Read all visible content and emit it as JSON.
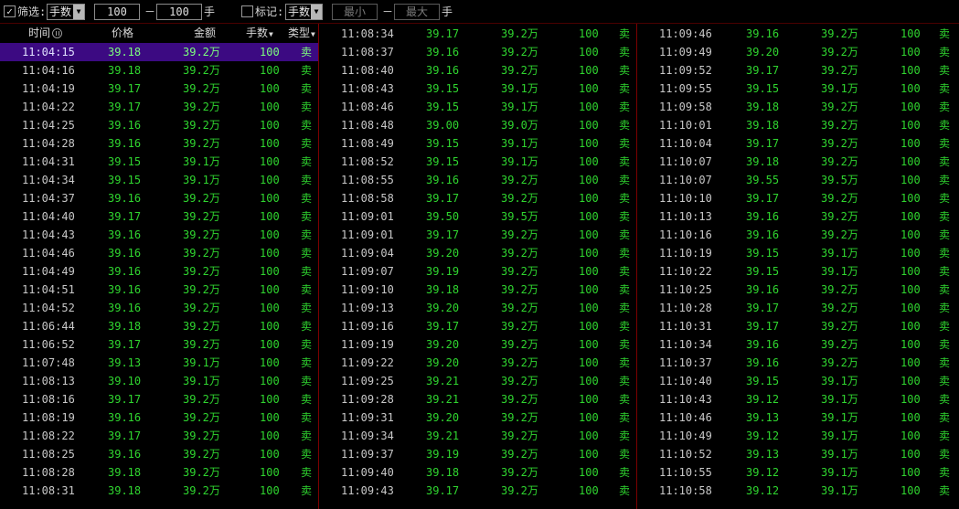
{
  "toolbar": {
    "filter_checked": true,
    "filter_label": "筛选:",
    "filter_field": "手数",
    "min_value": "100",
    "range_dash": "－",
    "max_value": "100",
    "unit": "手",
    "mark_checked": false,
    "mark_label": "标记:",
    "mark_field": "手数",
    "mark_min_placeholder": "最小",
    "mark_dash": "－",
    "mark_max_placeholder": "最大",
    "mark_unit": "手"
  },
  "headers": {
    "time": "时间",
    "price": "价格",
    "amount": "金额",
    "volume": "手数",
    "type": "类型"
  },
  "columns": [
    [
      [
        "11:04:15",
        "39.18",
        "39.2万",
        "100",
        "卖"
      ],
      [
        "11:04:16",
        "39.18",
        "39.2万",
        "100",
        "卖"
      ],
      [
        "11:04:19",
        "39.17",
        "39.2万",
        "100",
        "卖"
      ],
      [
        "11:04:22",
        "39.17",
        "39.2万",
        "100",
        "卖"
      ],
      [
        "11:04:25",
        "39.16",
        "39.2万",
        "100",
        "卖"
      ],
      [
        "11:04:28",
        "39.16",
        "39.2万",
        "100",
        "卖"
      ],
      [
        "11:04:31",
        "39.15",
        "39.1万",
        "100",
        "卖"
      ],
      [
        "11:04:34",
        "39.15",
        "39.1万",
        "100",
        "卖"
      ],
      [
        "11:04:37",
        "39.16",
        "39.2万",
        "100",
        "卖"
      ],
      [
        "11:04:40",
        "39.17",
        "39.2万",
        "100",
        "卖"
      ],
      [
        "11:04:43",
        "39.16",
        "39.2万",
        "100",
        "卖"
      ],
      [
        "11:04:46",
        "39.16",
        "39.2万",
        "100",
        "卖"
      ],
      [
        "11:04:49",
        "39.16",
        "39.2万",
        "100",
        "卖"
      ],
      [
        "11:04:51",
        "39.16",
        "39.2万",
        "100",
        "卖"
      ],
      [
        "11:04:52",
        "39.16",
        "39.2万",
        "100",
        "卖"
      ],
      [
        "11:06:44",
        "39.18",
        "39.2万",
        "100",
        "卖"
      ],
      [
        "11:06:52",
        "39.17",
        "39.2万",
        "100",
        "卖"
      ],
      [
        "11:07:48",
        "39.13",
        "39.1万",
        "100",
        "卖"
      ],
      [
        "11:08:13",
        "39.10",
        "39.1万",
        "100",
        "卖"
      ],
      [
        "11:08:16",
        "39.17",
        "39.2万",
        "100",
        "卖"
      ],
      [
        "11:08:19",
        "39.16",
        "39.2万",
        "100",
        "卖"
      ],
      [
        "11:08:22",
        "39.17",
        "39.2万",
        "100",
        "卖"
      ],
      [
        "11:08:25",
        "39.16",
        "39.2万",
        "100",
        "卖"
      ],
      [
        "11:08:28",
        "39.18",
        "39.2万",
        "100",
        "卖"
      ],
      [
        "11:08:31",
        "39.18",
        "39.2万",
        "100",
        "卖"
      ]
    ],
    [
      [
        "11:08:34",
        "39.17",
        "39.2万",
        "100",
        "卖"
      ],
      [
        "11:08:37",
        "39.16",
        "39.2万",
        "100",
        "卖"
      ],
      [
        "11:08:40",
        "39.16",
        "39.2万",
        "100",
        "卖"
      ],
      [
        "11:08:43",
        "39.15",
        "39.1万",
        "100",
        "卖"
      ],
      [
        "11:08:46",
        "39.15",
        "39.1万",
        "100",
        "卖"
      ],
      [
        "11:08:48",
        "39.00",
        "39.0万",
        "100",
        "卖"
      ],
      [
        "11:08:49",
        "39.15",
        "39.1万",
        "100",
        "卖"
      ],
      [
        "11:08:52",
        "39.15",
        "39.1万",
        "100",
        "卖"
      ],
      [
        "11:08:55",
        "39.16",
        "39.2万",
        "100",
        "卖"
      ],
      [
        "11:08:58",
        "39.17",
        "39.2万",
        "100",
        "卖"
      ],
      [
        "11:09:01",
        "39.50",
        "39.5万",
        "100",
        "卖"
      ],
      [
        "11:09:01",
        "39.17",
        "39.2万",
        "100",
        "卖"
      ],
      [
        "11:09:04",
        "39.20",
        "39.2万",
        "100",
        "卖"
      ],
      [
        "11:09:07",
        "39.19",
        "39.2万",
        "100",
        "卖"
      ],
      [
        "11:09:10",
        "39.18",
        "39.2万",
        "100",
        "卖"
      ],
      [
        "11:09:13",
        "39.20",
        "39.2万",
        "100",
        "卖"
      ],
      [
        "11:09:16",
        "39.17",
        "39.2万",
        "100",
        "卖"
      ],
      [
        "11:09:19",
        "39.20",
        "39.2万",
        "100",
        "卖"
      ],
      [
        "11:09:22",
        "39.20",
        "39.2万",
        "100",
        "卖"
      ],
      [
        "11:09:25",
        "39.21",
        "39.2万",
        "100",
        "卖"
      ],
      [
        "11:09:28",
        "39.21",
        "39.2万",
        "100",
        "卖"
      ],
      [
        "11:09:31",
        "39.20",
        "39.2万",
        "100",
        "卖"
      ],
      [
        "11:09:34",
        "39.21",
        "39.2万",
        "100",
        "卖"
      ],
      [
        "11:09:37",
        "39.19",
        "39.2万",
        "100",
        "卖"
      ],
      [
        "11:09:40",
        "39.18",
        "39.2万",
        "100",
        "卖"
      ],
      [
        "11:09:43",
        "39.17",
        "39.2万",
        "100",
        "卖"
      ]
    ],
    [
      [
        "11:09:46",
        "39.16",
        "39.2万",
        "100",
        "卖"
      ],
      [
        "11:09:49",
        "39.20",
        "39.2万",
        "100",
        "卖"
      ],
      [
        "11:09:52",
        "39.17",
        "39.2万",
        "100",
        "卖"
      ],
      [
        "11:09:55",
        "39.15",
        "39.1万",
        "100",
        "卖"
      ],
      [
        "11:09:58",
        "39.18",
        "39.2万",
        "100",
        "卖"
      ],
      [
        "11:10:01",
        "39.18",
        "39.2万",
        "100",
        "卖"
      ],
      [
        "11:10:04",
        "39.17",
        "39.2万",
        "100",
        "卖"
      ],
      [
        "11:10:07",
        "39.18",
        "39.2万",
        "100",
        "卖"
      ],
      [
        "11:10:07",
        "39.55",
        "39.5万",
        "100",
        "卖"
      ],
      [
        "11:10:10",
        "39.17",
        "39.2万",
        "100",
        "卖"
      ],
      [
        "11:10:13",
        "39.16",
        "39.2万",
        "100",
        "卖"
      ],
      [
        "11:10:16",
        "39.16",
        "39.2万",
        "100",
        "卖"
      ],
      [
        "11:10:19",
        "39.15",
        "39.1万",
        "100",
        "卖"
      ],
      [
        "11:10:22",
        "39.15",
        "39.1万",
        "100",
        "卖"
      ],
      [
        "11:10:25",
        "39.16",
        "39.2万",
        "100",
        "卖"
      ],
      [
        "11:10:28",
        "39.17",
        "39.2万",
        "100",
        "卖"
      ],
      [
        "11:10:31",
        "39.17",
        "39.2万",
        "100",
        "卖"
      ],
      [
        "11:10:34",
        "39.16",
        "39.2万",
        "100",
        "卖"
      ],
      [
        "11:10:37",
        "39.16",
        "39.2万",
        "100",
        "卖"
      ],
      [
        "11:10:40",
        "39.15",
        "39.1万",
        "100",
        "卖"
      ],
      [
        "11:10:43",
        "39.12",
        "39.1万",
        "100",
        "卖"
      ],
      [
        "11:10:46",
        "39.13",
        "39.1万",
        "100",
        "卖"
      ],
      [
        "11:10:49",
        "39.12",
        "39.1万",
        "100",
        "卖"
      ],
      [
        "11:10:52",
        "39.13",
        "39.1万",
        "100",
        "卖"
      ],
      [
        "11:10:55",
        "39.12",
        "39.1万",
        "100",
        "卖"
      ],
      [
        "11:10:58",
        "39.12",
        "39.1万",
        "100",
        "卖"
      ]
    ]
  ],
  "colors": {
    "background": "#000000",
    "time_text": "#c8c8c8",
    "value_green": "#2fd52f",
    "selected_row": "#3c0a82",
    "column_divider": "#7a0000"
  },
  "icons": [
    "checkbox-checked-icon",
    "dropdown-arrow-icon",
    "checkbox-unchecked-icon",
    "pause-icon",
    "sort-down-icon"
  ]
}
